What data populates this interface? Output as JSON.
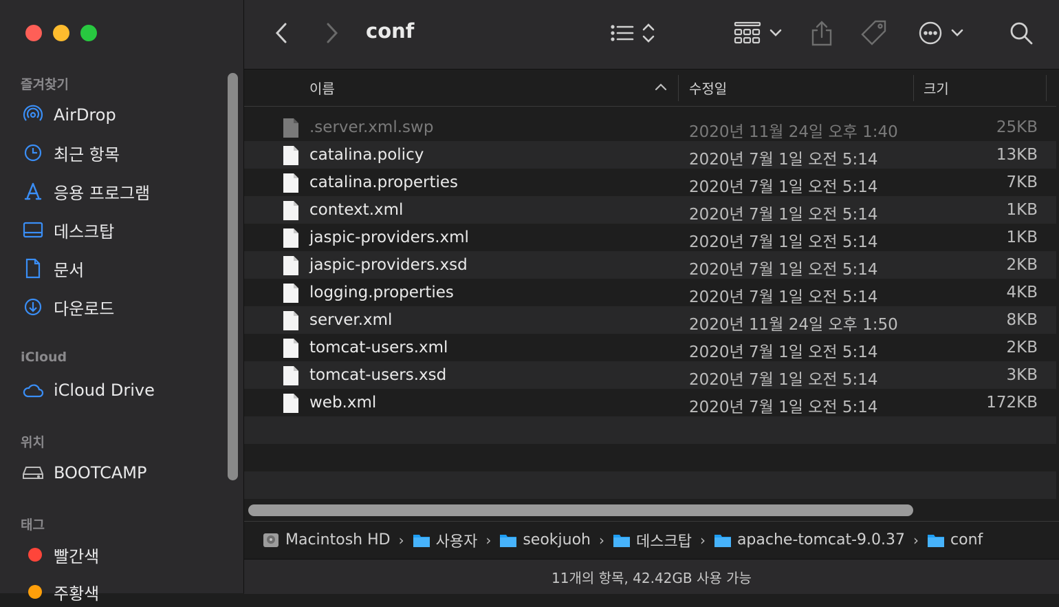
{
  "window": {
    "title": "conf"
  },
  "sidebar": {
    "favorites_header": "즐겨찾기",
    "favorites": [
      {
        "label": "AirDrop",
        "icon": "airdrop-icon"
      },
      {
        "label": "최근 항목",
        "icon": "clock-icon"
      },
      {
        "label": "응용 프로그램",
        "icon": "applications-icon"
      },
      {
        "label": "데스크탑",
        "icon": "desktop-icon"
      },
      {
        "label": "문서",
        "icon": "document-icon"
      },
      {
        "label": "다운로드",
        "icon": "download-icon"
      }
    ],
    "icloud_header": "iCloud",
    "icloud": [
      {
        "label": "iCloud Drive",
        "icon": "cloud-icon"
      }
    ],
    "locations_header": "위치",
    "locations": [
      {
        "label": "BOOTCAMP",
        "icon": "drive-icon"
      }
    ],
    "tags_header": "태그",
    "tags": [
      {
        "label": "빨간색",
        "color": "#ff453a"
      },
      {
        "label": "주황색",
        "color": "#ff9f0a"
      }
    ]
  },
  "columns": {
    "name": "이름",
    "modified": "수정일",
    "size": "크기"
  },
  "files": [
    {
      "name": ".server.xml.swp",
      "date": "2020년 11월 24일 오후 1:40",
      "size": "25KB",
      "hidden": true
    },
    {
      "name": "catalina.policy",
      "date": "2020년 7월 1일 오전 5:14",
      "size": "13KB"
    },
    {
      "name": "catalina.properties",
      "date": "2020년 7월 1일 오전 5:14",
      "size": "7KB"
    },
    {
      "name": "context.xml",
      "date": "2020년 7월 1일 오전 5:14",
      "size": "1KB"
    },
    {
      "name": "jaspic-providers.xml",
      "date": "2020년 7월 1일 오전 5:14",
      "size": "1KB"
    },
    {
      "name": "jaspic-providers.xsd",
      "date": "2020년 7월 1일 오전 5:14",
      "size": "2KB"
    },
    {
      "name": "logging.properties",
      "date": "2020년 7월 1일 오전 5:14",
      "size": "4KB"
    },
    {
      "name": "server.xml",
      "date": "2020년 11월 24일 오후 1:50",
      "size": "8KB"
    },
    {
      "name": "tomcat-users.xml",
      "date": "2020년 7월 1일 오전 5:14",
      "size": "2KB"
    },
    {
      "name": "tomcat-users.xsd",
      "date": "2020년 7월 1일 오전 5:14",
      "size": "3KB"
    },
    {
      "name": "web.xml",
      "date": "2020년 7월 1일 오전 5:14",
      "size": "172KB"
    }
  ],
  "path": [
    {
      "label": "Macintosh HD",
      "icon": "hard-drive-icon"
    },
    {
      "label": "사용자",
      "icon": "folder-users-icon"
    },
    {
      "label": "seokjuoh",
      "icon": "home-folder-icon"
    },
    {
      "label": "데스크탑",
      "icon": "desktop-folder-icon"
    },
    {
      "label": "apache-tomcat-9.0.37",
      "icon": "folder-icon"
    },
    {
      "label": "conf",
      "icon": "folder-icon"
    }
  ],
  "path_separator": "›",
  "status": "11개의 항목, 42.42GB 사용 가능"
}
